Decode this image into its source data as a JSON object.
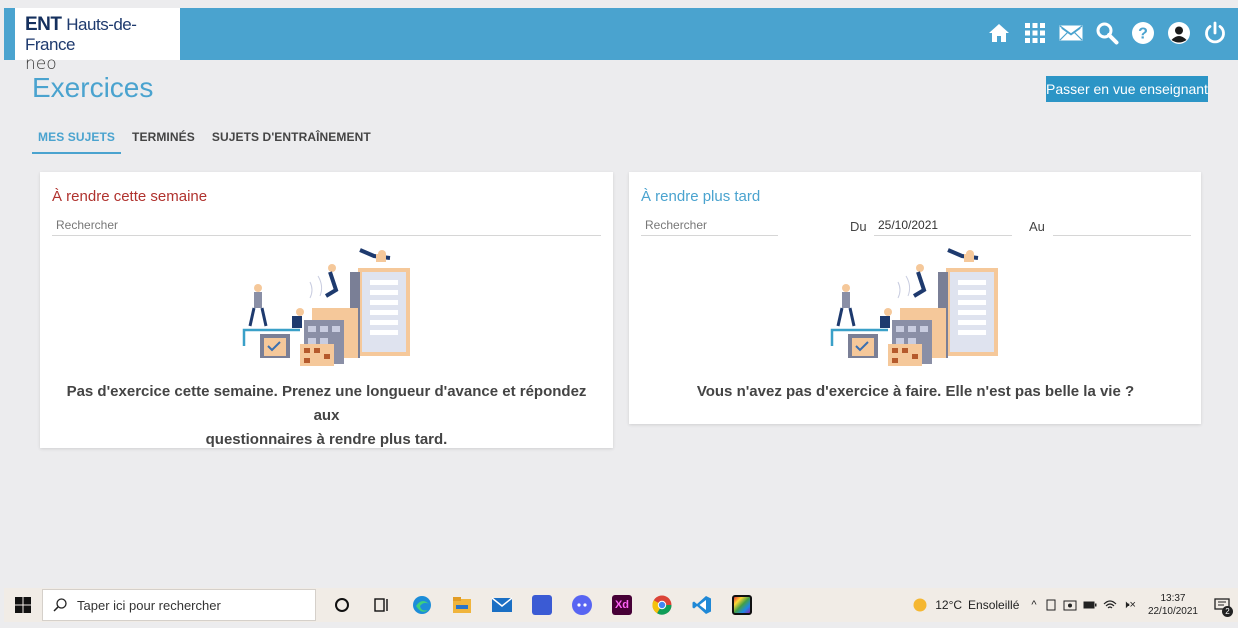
{
  "brand": {
    "ent": "ENT",
    "region": "Hauts-de-France",
    "sub": "neo"
  },
  "header_icons": [
    "home-icon",
    "apps-grid-icon",
    "mail-icon",
    "search-icon",
    "help-icon",
    "profile-icon",
    "power-icon"
  ],
  "page": {
    "title": "Exercices",
    "teacher_button": "Passer en vue enseignant"
  },
  "tabs": [
    {
      "label": "MES SUJETS",
      "active": true
    },
    {
      "label": "TERMINÉS",
      "active": false
    },
    {
      "label": "SUJETS D'ENTRAÎNEMENT",
      "active": false
    }
  ],
  "week_card": {
    "title": "À rendre cette semaine",
    "search_placeholder": "Rechercher",
    "message_line1": "Pas d'exercice cette semaine. Prenez une longueur d'avance et répondez aux",
    "message_line2": "questionnaires à rendre plus tard."
  },
  "later_card": {
    "title": "À rendre plus tard",
    "search_placeholder": "Rechercher",
    "from_label": "Du",
    "from_value": "25/10/2021",
    "to_label": "Au",
    "to_value": "",
    "message": "Vous n'avez pas d'exercice à faire. Elle n'est pas belle la vie ?"
  },
  "taskbar": {
    "search_placeholder": "Taper ici pour rechercher",
    "apps": [
      "cortana-icon",
      "task-view-icon",
      "edge-icon",
      "file-explorer-icon",
      "mail-app-icon",
      "editor-app-icon",
      "discord-icon",
      "adobe-xd-icon",
      "chrome-icon",
      "vscode-icon",
      "image-app-icon"
    ],
    "weather_temp": "12°C",
    "weather_text": "Ensoleillé",
    "time": "13:37",
    "date": "22/10/2021",
    "notification_count": "2"
  },
  "colors": {
    "accent": "#4aa3cf",
    "week_title": "#b0322e",
    "header": "#4aa3cf"
  }
}
